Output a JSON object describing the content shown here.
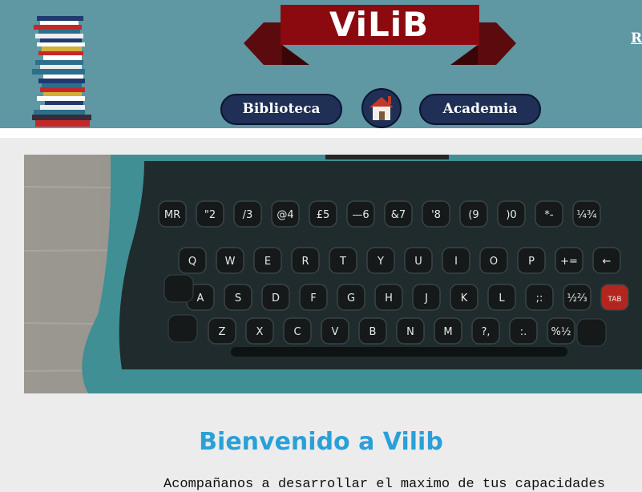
{
  "header": {
    "logo": "ViLiB",
    "nav": {
      "left_label": "Biblioteca",
      "right_label": "Academia"
    },
    "home_icon": "house-icon",
    "corner_link": "R"
  },
  "hero": {
    "image": "typewriter-keyboard",
    "key_rows": [
      [
        "MR",
        "\"2",
        "/3",
        "@4",
        "£5",
        "—6",
        "&7",
        "'8",
        "(9",
        ")0",
        "*-",
        "¼¾"
      ],
      [
        "Q",
        "W",
        "E",
        "R",
        "T",
        "Y",
        "U",
        "I",
        "O",
        "P",
        "+=",
        "←"
      ],
      [
        "A",
        "S",
        "D",
        "F",
        "G",
        "H",
        "J",
        "K",
        "L",
        ";:",
        "½⅔",
        "TAB"
      ],
      [
        "Z",
        "X",
        "C",
        "V",
        "B",
        "N",
        "M",
        "?,",
        ":.",
        "%½"
      ]
    ]
  },
  "main": {
    "welcome": "Bienvenido a Vilib",
    "subtitle": "Acompañanos a desarrollar el maximo de tus capacidades"
  },
  "colors": {
    "header_bg": "#5f97a3",
    "logo_red": "#8b0a10",
    "nav_bg": "#1f2f55",
    "welcome": "#2aa0d8"
  }
}
